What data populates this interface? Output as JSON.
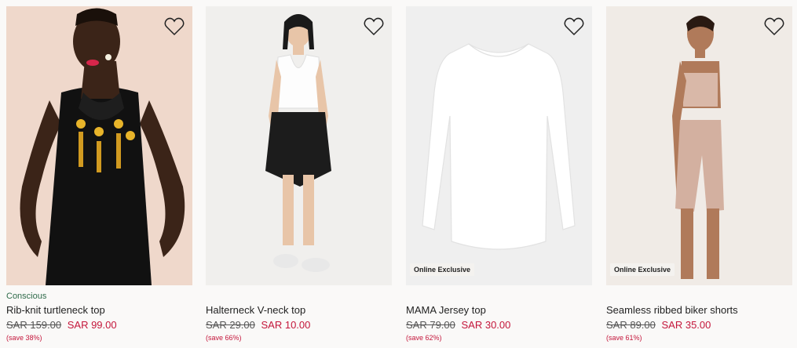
{
  "products": [
    {
      "tag": "Conscious",
      "name": "Rib-knit turtleneck top",
      "old_price": "SAR 159.00",
      "new_price": "SAR 99.00",
      "save": "(save 38%)",
      "badge": ""
    },
    {
      "tag": "",
      "name": "Halterneck V-neck top",
      "old_price": "SAR 29.00",
      "new_price": "SAR 10.00",
      "save": "(save 66%)",
      "badge": ""
    },
    {
      "tag": "",
      "name": "MAMA Jersey top",
      "old_price": "SAR 79.00",
      "new_price": "SAR 30.00",
      "save": "(save 62%)",
      "badge": "Online Exclusive"
    },
    {
      "tag": "",
      "name": "Seamless ribbed biker shorts",
      "old_price": "SAR 89.00",
      "new_price": "SAR 35.00",
      "save": "(save 61%)",
      "badge": "Online Exclusive"
    }
  ],
  "icons": {
    "favorite": "heart-outline-icon"
  },
  "colors": {
    "sale": "#c4163b",
    "conscious": "#2f6b4a",
    "background": "#faf9f8"
  }
}
